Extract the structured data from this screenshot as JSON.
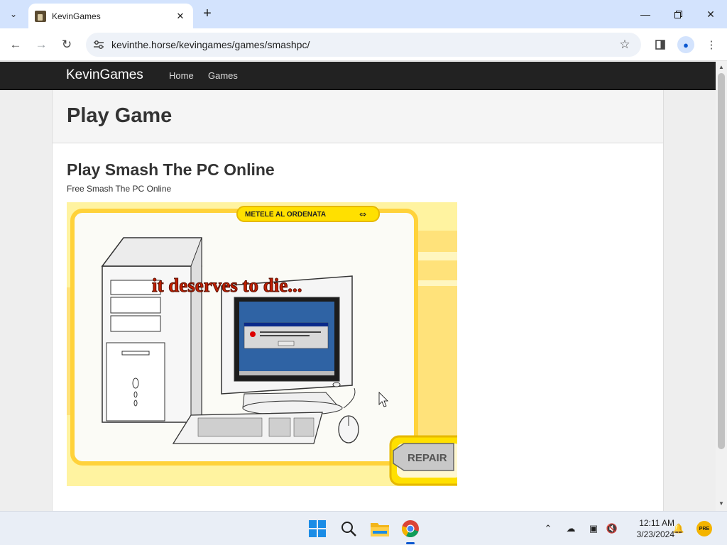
{
  "browser": {
    "tab_title": "KevinGames",
    "url": "kevinthe.horse/kevingames/games/smashpc/",
    "icons": {
      "tab_search": "chevron-down-icon",
      "close_tab": "close-icon",
      "new_tab": "plus-icon",
      "back": "arrow-left-icon",
      "forward": "arrow-right-icon",
      "reload": "reload-icon",
      "site_info": "tune-icon",
      "bookmark": "star-icon",
      "side_panel": "side-panel-icon",
      "profile": "person-icon",
      "menu": "kebab-menu-icon"
    }
  },
  "site": {
    "brand": "KevinGames",
    "nav": [
      "Home",
      "Games"
    ]
  },
  "page": {
    "header_title": "Play Game",
    "game_title": "Play Smash The PC Online",
    "game_subtitle": "Free Smash The PC Online"
  },
  "game": {
    "banner": "METELE AL ORDENATA",
    "overlay_text": "it deserves to die...",
    "repair_label": "REPAIR"
  },
  "taskbar": {
    "time": "12:11 AM",
    "date": "3/23/2024",
    "apps": [
      "windows-start-icon",
      "search-icon",
      "file-explorer-icon",
      "chrome-icon"
    ],
    "tray": [
      "chevron-up-icon",
      "onedrive-offline-icon",
      "display-icon",
      "volume-muted-icon",
      "notification-bell-icon",
      "weather-pre-icon"
    ]
  },
  "colors": {
    "tab_strip": "#d3e3fd",
    "navbar": "#222222",
    "game_background": "#fff6b0",
    "overlay_text": "#c21f00"
  }
}
